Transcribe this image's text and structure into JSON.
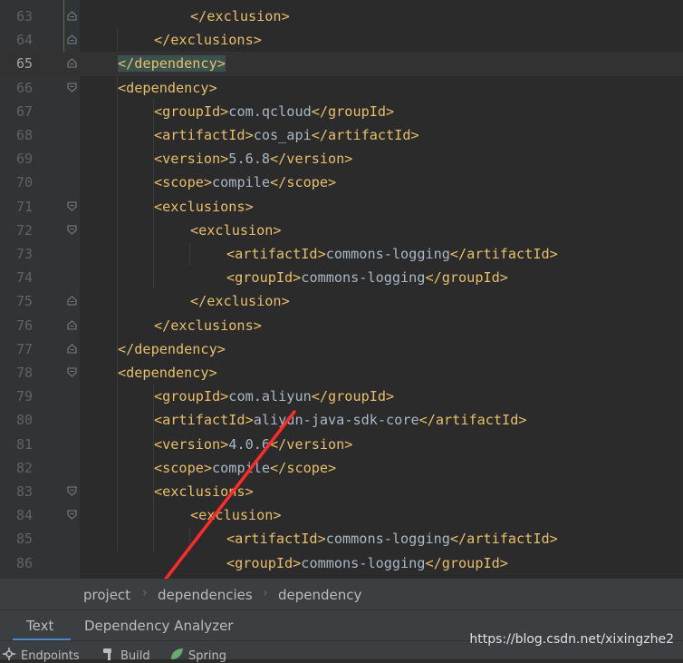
{
  "editor": {
    "current_line": "65",
    "lines": [
      {
        "n": "63",
        "indent": 3,
        "parts": [
          {
            "c": "tag",
            "t": "</exclusion>"
          }
        ]
      },
      {
        "n": "64",
        "indent": 2,
        "parts": [
          {
            "c": "tag",
            "t": "</exclusions>"
          }
        ]
      },
      {
        "n": "65",
        "indent": 1,
        "parts": [
          {
            "c": "tag hl",
            "t": "</dependency>"
          }
        ]
      },
      {
        "n": "66",
        "indent": 1,
        "parts": [
          {
            "c": "tag",
            "t": "<dependency>"
          }
        ]
      },
      {
        "n": "67",
        "indent": 2,
        "parts": [
          {
            "c": "tag",
            "t": "<groupId>"
          },
          {
            "c": "txt",
            "t": "com.qcloud"
          },
          {
            "c": "tag",
            "t": "</groupId>"
          }
        ]
      },
      {
        "n": "68",
        "indent": 2,
        "parts": [
          {
            "c": "tag",
            "t": "<artifactId>"
          },
          {
            "c": "txt",
            "t": "cos_api"
          },
          {
            "c": "tag",
            "t": "</artifactId>"
          }
        ]
      },
      {
        "n": "69",
        "indent": 2,
        "parts": [
          {
            "c": "tag",
            "t": "<version>"
          },
          {
            "c": "txt",
            "t": "5.6.8"
          },
          {
            "c": "tag",
            "t": "</version>"
          }
        ]
      },
      {
        "n": "70",
        "indent": 2,
        "parts": [
          {
            "c": "tag",
            "t": "<scope>"
          },
          {
            "c": "txt",
            "t": "compile"
          },
          {
            "c": "tag",
            "t": "</scope>"
          }
        ]
      },
      {
        "n": "71",
        "indent": 2,
        "parts": [
          {
            "c": "tag",
            "t": "<exclusions>"
          }
        ]
      },
      {
        "n": "72",
        "indent": 3,
        "parts": [
          {
            "c": "tag",
            "t": "<exclusion>"
          }
        ]
      },
      {
        "n": "73",
        "indent": 4,
        "parts": [
          {
            "c": "tag",
            "t": "<artifactId>"
          },
          {
            "c": "txt",
            "t": "commons-logging"
          },
          {
            "c": "tag",
            "t": "</artifactId>"
          }
        ]
      },
      {
        "n": "74",
        "indent": 4,
        "parts": [
          {
            "c": "tag",
            "t": "<groupId>"
          },
          {
            "c": "txt",
            "t": "commons-logging"
          },
          {
            "c": "tag",
            "t": "</groupId>"
          }
        ]
      },
      {
        "n": "75",
        "indent": 3,
        "parts": [
          {
            "c": "tag",
            "t": "</exclusion>"
          }
        ]
      },
      {
        "n": "76",
        "indent": 2,
        "parts": [
          {
            "c": "tag",
            "t": "</exclusions>"
          }
        ]
      },
      {
        "n": "77",
        "indent": 1,
        "parts": [
          {
            "c": "tag",
            "t": "</dependency>"
          }
        ]
      },
      {
        "n": "78",
        "indent": 1,
        "parts": [
          {
            "c": "tag",
            "t": "<dependency>"
          }
        ]
      },
      {
        "n": "79",
        "indent": 2,
        "parts": [
          {
            "c": "tag",
            "t": "<groupId>"
          },
          {
            "c": "txt",
            "t": "com.aliyun"
          },
          {
            "c": "tag",
            "t": "</groupId>"
          }
        ]
      },
      {
        "n": "80",
        "indent": 2,
        "parts": [
          {
            "c": "tag",
            "t": "<artifactId>"
          },
          {
            "c": "txt",
            "t": "aliyun-java-sdk-core"
          },
          {
            "c": "tag",
            "t": "</artifactId>"
          }
        ]
      },
      {
        "n": "81",
        "indent": 2,
        "parts": [
          {
            "c": "tag",
            "t": "<version>"
          },
          {
            "c": "txt",
            "t": "4.0.6"
          },
          {
            "c": "tag",
            "t": "</version>"
          }
        ]
      },
      {
        "n": "82",
        "indent": 2,
        "parts": [
          {
            "c": "tag",
            "t": "<scope>"
          },
          {
            "c": "txt",
            "t": "compile"
          },
          {
            "c": "tag",
            "t": "</scope>"
          }
        ]
      },
      {
        "n": "83",
        "indent": 2,
        "parts": [
          {
            "c": "tag",
            "t": "<exclusions>"
          }
        ]
      },
      {
        "n": "84",
        "indent": 3,
        "parts": [
          {
            "c": "tag",
            "t": "<exclusion>"
          }
        ]
      },
      {
        "n": "85",
        "indent": 4,
        "parts": [
          {
            "c": "tag",
            "t": "<artifactId>"
          },
          {
            "c": "txt",
            "t": "commons-logging"
          },
          {
            "c": "tag",
            "t": "</artifactId>"
          }
        ]
      },
      {
        "n": "86",
        "indent": 4,
        "parts": [
          {
            "c": "tag",
            "t": "<groupId>"
          },
          {
            "c": "txt",
            "t": "commons-logging"
          },
          {
            "c": "tag",
            "t": "</groupId>"
          }
        ]
      }
    ],
    "fold_icons": {
      "63": "fold-end",
      "64": "fold-end",
      "65": "fold-end",
      "66": "fold-start",
      "71": "fold-start",
      "72": "fold-start",
      "75": "fold-end",
      "76": "fold-end",
      "77": "fold-end",
      "78": "fold-start",
      "83": "fold-start",
      "84": "fold-start"
    }
  },
  "breadcrumb": [
    "project",
    "dependencies",
    "dependency"
  ],
  "tabs": {
    "text": "Text",
    "dependency_analyzer": "Dependency Analyzer",
    "active": "Text"
  },
  "toolstrip": {
    "endpoints": "Endpoints",
    "build": "Build",
    "spring": "Spring"
  },
  "watermark": "https://blog.csdn.net/xixingzhe2",
  "colors": {
    "background": "#2b2b2b",
    "gutter": "#313335",
    "xml_tag": "#e8bf6a",
    "text": "#a9b7c6",
    "line_number": "#606366",
    "tag_match_highlight": "#3b514d",
    "annotation_arrow": "#ff2a2a",
    "tab_underline": "#4a88c7"
  }
}
